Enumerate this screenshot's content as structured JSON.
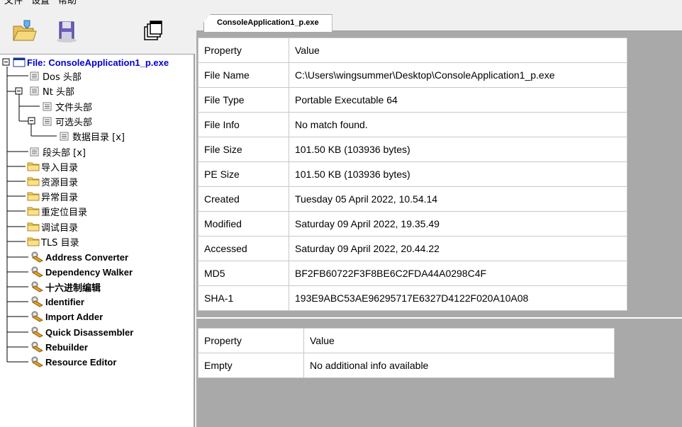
{
  "menu": [
    "文件",
    "设置",
    "帮助"
  ],
  "toolbar": {
    "icons": [
      "open-folder-icon",
      "save-disk-icon",
      "windows-icon"
    ]
  },
  "tree": {
    "items": [
      {
        "label": "File: ConsoleApplication1_p.exe",
        "icon": "window-icon"
      },
      {
        "label": "Dos 头部",
        "icon": "doc-icon"
      },
      {
        "label": "Nt 头部",
        "icon": "doc-icon"
      },
      {
        "label": "文件头部",
        "icon": "doc-icon"
      },
      {
        "label": "可选头部",
        "icon": "doc-icon"
      },
      {
        "label": "数据目录 [x]",
        "icon": "doc-icon"
      },
      {
        "label": "段头部 [x]",
        "icon": "doc-icon"
      },
      {
        "label": "导入目录",
        "icon": "folder-icon"
      },
      {
        "label": "资源目录",
        "icon": "folder-icon"
      },
      {
        "label": "异常目录",
        "icon": "folder-icon"
      },
      {
        "label": "重定位目录",
        "icon": "folder-icon"
      },
      {
        "label": "调试目录",
        "icon": "folder-icon"
      },
      {
        "label": "TLS 目录",
        "icon": "folder-icon"
      },
      {
        "label": "Address Converter",
        "icon": "tool-icon"
      },
      {
        "label": "Dependency Walker",
        "icon": "tool-icon"
      },
      {
        "label": "十六进制编辑",
        "icon": "tool-icon"
      },
      {
        "label": "Identifier",
        "icon": "tool-icon"
      },
      {
        "label": "Import Adder",
        "icon": "tool-icon"
      },
      {
        "label": "Quick Disassembler",
        "icon": "tool-icon"
      },
      {
        "label": "Rebuilder",
        "icon": "tool-icon"
      },
      {
        "label": "Resource Editor",
        "icon": "tool-icon"
      }
    ]
  },
  "tab": {
    "label": "ConsoleApplication1_p.exe"
  },
  "props": {
    "header": {
      "property": "Property",
      "value": "Value"
    },
    "rows": [
      {
        "property": "File Name",
        "value": "C:\\Users\\wingsummer\\Desktop\\ConsoleApplication1_p.exe"
      },
      {
        "property": "File Type",
        "value": "Portable Executable 64"
      },
      {
        "property": "File Info",
        "value": "No match found."
      },
      {
        "property": "File Size",
        "value": "101.50 KB (103936 bytes)"
      },
      {
        "property": "PE Size",
        "value": "101.50 KB (103936 bytes)"
      },
      {
        "property": "Created",
        "value": "Tuesday 05 April 2022, 10.54.14"
      },
      {
        "property": "Modified",
        "value": "Saturday 09 April 2022, 19.35.49"
      },
      {
        "property": "Accessed",
        "value": "Saturday 09 April 2022, 20.44.22"
      },
      {
        "property": "MD5",
        "value": "BF2FB60722F3F8BE6C2FDA44A0298C4F"
      },
      {
        "property": "SHA-1",
        "value": "193E9ABC53AE96295717E6327D4122F020A10A08"
      }
    ]
  },
  "extra": {
    "header": {
      "property": "Property",
      "value": "Value"
    },
    "rows": [
      {
        "property": "Empty",
        "value": "No additional info available"
      }
    ]
  }
}
